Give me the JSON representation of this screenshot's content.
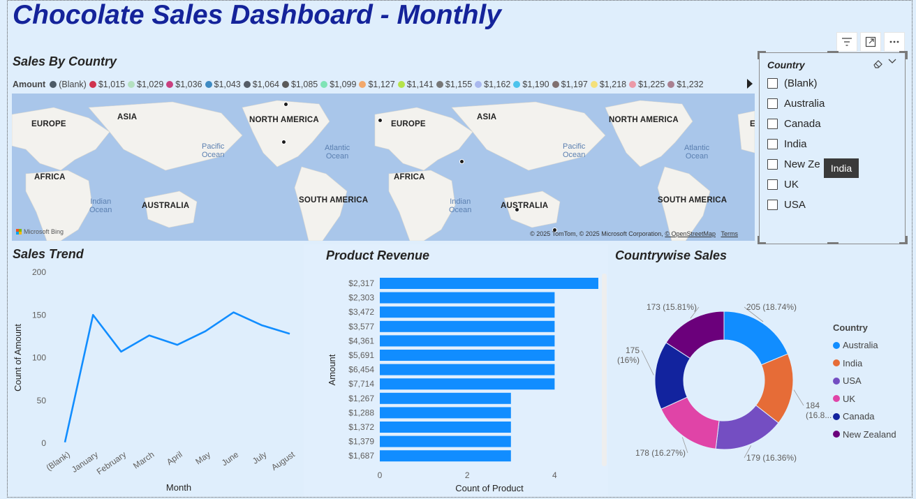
{
  "title": "Chocolate Sales Dashboard - Monthly",
  "visual_header": {
    "icons": [
      "filter-icon",
      "focus-mode-icon",
      "more-options-icon"
    ]
  },
  "map": {
    "title": "Sales By Country",
    "legend_title": "Amount",
    "legend": [
      {
        "label": "(Blank)",
        "color": "#4c5a66"
      },
      {
        "label": "$1,015",
        "color": "#d0334e"
      },
      {
        "label": "$1,029",
        "color": "#b4e0c0"
      },
      {
        "label": "$1,036",
        "color": "#c9407f"
      },
      {
        "label": "$1,043",
        "color": "#3e8ac2"
      },
      {
        "label": "$1,064",
        "color": "#555c66"
      },
      {
        "label": "$1,085",
        "color": "#5a5a5a"
      },
      {
        "label": "$1,099",
        "color": "#7fe3b5"
      },
      {
        "label": "$1,127",
        "color": "#f2a86b"
      },
      {
        "label": "$1,141",
        "color": "#b5e34a"
      },
      {
        "label": "$1,155",
        "color": "#777777"
      },
      {
        "label": "$1,162",
        "color": "#a9b8ee"
      },
      {
        "label": "$1,190",
        "color": "#4cc3ec"
      },
      {
        "label": "$1,197",
        "color": "#807070"
      },
      {
        "label": "$1,218",
        "color": "#f4e07a"
      },
      {
        "label": "$1,225",
        "color": "#ec9aa8"
      },
      {
        "label": "$1,232",
        "color": "#a98090"
      }
    ],
    "continents": [
      "EUROPE",
      "ASIA",
      "NORTH AMERICA",
      "EUROPE",
      "ASIA",
      "NORTH AMERICA",
      "E",
      "AFRICA",
      "AUSTRALIA",
      "SOUTH AMERICA",
      "AFRICA",
      "AUSTRALIA",
      "SOUTH AMERICA"
    ],
    "oceans": [
      "Pacific\nOcean",
      "Atlantic\nOcean",
      "Indian\nOcean",
      "Indian\nOcean",
      "Pacific\nOcean",
      "Atlantic\nOcean"
    ],
    "bing": "Microsoft Bing",
    "attribution": "© 2025 TomTom, © 2025 Microsoft Corporation, ",
    "attribution_osm": "© OpenStreetMap",
    "attribution_terms": "Terms"
  },
  "slicer": {
    "title": "Country",
    "items": [
      "(Blank)",
      "Australia",
      "Canada",
      "India",
      "New Ze",
      "UK",
      "USA"
    ],
    "tooltip": "India"
  },
  "sales_trend": {
    "title": "Sales Trend",
    "chart_data": {
      "type": "line",
      "x": [
        "(Blank)",
        "January",
        "February",
        "March",
        "April",
        "May",
        "June",
        "July",
        "August"
      ],
      "values": [
        1,
        150,
        107,
        126,
        115,
        131,
        153,
        138,
        128
      ],
      "xlabel": "Month",
      "ylabel": "Count of Amount",
      "ylim": [
        0,
        200
      ],
      "yticks": [
        "0",
        "50",
        "100",
        "150",
        "200"
      ],
      "color": "#118dff"
    }
  },
  "product_revenue": {
    "title": "Product Revenue",
    "chart_data": {
      "type": "bar",
      "orientation": "horizontal",
      "categories": [
        "$2,317",
        "$2,303",
        "$3,472",
        "$3,577",
        "$4,361",
        "$5,691",
        "$6,454",
        "$7,714",
        "$1,267",
        "$1,288",
        "$1,372",
        "$1,379",
        "$1,687"
      ],
      "values": [
        5,
        4,
        4,
        4,
        4,
        4,
        4,
        4,
        3,
        3,
        3,
        3,
        3
      ],
      "xlabel": "Count of Product",
      "ylabel": "Amount",
      "xlim": [
        0,
        5
      ],
      "xticks": [
        "0",
        "2",
        "4"
      ],
      "color": "#118dff"
    }
  },
  "countrywise": {
    "title": "Countrywise Sales",
    "legend_title": "Country",
    "chart_data": {
      "type": "pie",
      "donut": true,
      "labels": [
        "Australia",
        "India",
        "USA",
        "UK",
        "Canada",
        "New Zealand"
      ],
      "values": [
        205,
        184,
        179,
        178,
        175,
        173
      ],
      "data_labels": [
        "205 (18.74%)",
        "184\n(16.8...)",
        "179 (16.36%)",
        "178 (16.27%)",
        "175\n(16%)",
        "173 (15.81%)"
      ],
      "colors": [
        "#118dff",
        "#e66c37",
        "#744ec2",
        "#e044a7",
        "#12239e",
        "#6b007b"
      ]
    }
  }
}
